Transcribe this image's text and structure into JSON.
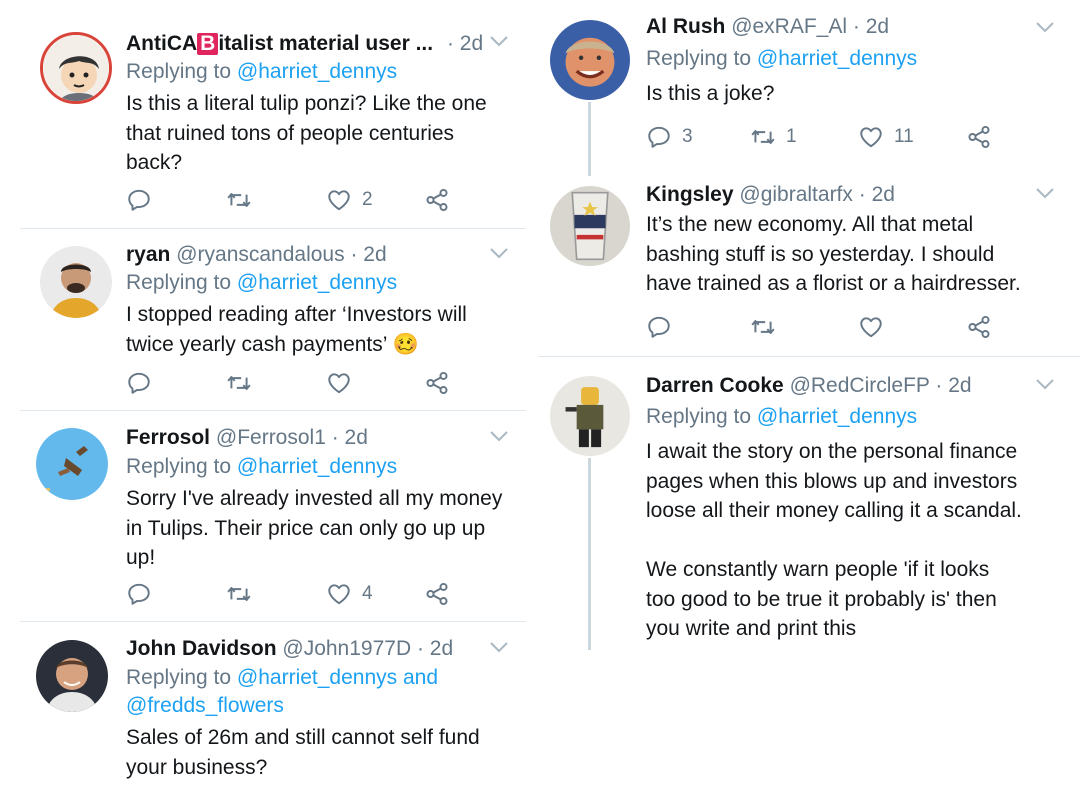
{
  "left_tweets": [
    {
      "name": "AntiCA",
      "name_badge": "B",
      "name_suffix": "italist material user ...",
      "handle": "",
      "time": "· 2d",
      "replying_prefix": "Replying to ",
      "replying_to": "@harriet_dennys",
      "body_lines": [
        "Is this a literal tulip ponzi? Like the one",
        "that ruined tons of people centuries",
        "back?"
      ],
      "reply_count": "",
      "retweet_count": "",
      "like_count": "2"
    },
    {
      "name": "ryan",
      "handle": "@ryanscandalous",
      "time": "· 2d",
      "replying_prefix": "Replying to ",
      "replying_to": "@harriet_dennys",
      "body_lines": [
        "I stopped reading after ‘Investors will",
        "twice yearly cash payments’ 🥴"
      ],
      "reply_count": "",
      "retweet_count": "",
      "like_count": ""
    },
    {
      "name": "Ferrosol",
      "handle": "@Ferrosol1",
      "time": "· 2d",
      "replying_prefix": "Replying to ",
      "replying_to": "@harriet_dennys",
      "body_lines": [
        "Sorry I've already invested all my money",
        "in Tulips. Their price can only go up up",
        "up!"
      ],
      "reply_count": "",
      "retweet_count": "",
      "like_count": "4"
    },
    {
      "name": "John Davidson",
      "handle": "@John1977D",
      "time": "· 2d",
      "replying_prefix": "Replying to ",
      "replying_to": "@harriet_dennys and",
      "replying_to_2": "@fredds_flowers",
      "body_lines": [
        "Sales of 26m and still cannot self fund",
        "your business?"
      ]
    }
  ],
  "right_tweets": [
    {
      "name": "Al Rush",
      "handle": "@exRAF_Al",
      "time": "· 2d",
      "replying_prefix": "Replying to ",
      "replying_to": "@harriet_dennys",
      "body_lines": [
        "Is this a joke?"
      ],
      "reply_count": "3",
      "retweet_count": "1",
      "like_count": "11"
    },
    {
      "name": "Kingsley",
      "handle": "@gibraltarfx",
      "time": "· 2d",
      "body_lines": [
        "It’s the new economy. All that  metal",
        "bashing stuff is so yesterday. I should",
        "have trained as a florist or a hairdresser."
      ],
      "reply_count": "",
      "retweet_count": "",
      "like_count": ""
    },
    {
      "name": "Darren Cooke",
      "handle": "@RedCircleFP",
      "time": "· 2d",
      "replying_prefix": "Replying to ",
      "replying_to": "@harriet_dennys",
      "body_lines": [
        "I await the story on the personal finance",
        "pages when this blows up and investors",
        "loose all their money calling it a scandal.",
        "",
        "We constantly warn people 'if it looks",
        "too good to be true it probably is' then",
        "you write and print this"
      ]
    }
  ],
  "icons": {
    "reply": "reply-icon",
    "retweet": "retweet-icon",
    "like": "heart-icon",
    "share": "share-icon",
    "more": "chevron-down-icon"
  },
  "colors": {
    "link": "#1da1f2",
    "muted": "#657786",
    "text": "#14171a",
    "divider": "#e1e8ed",
    "badge": "#e0245e"
  }
}
